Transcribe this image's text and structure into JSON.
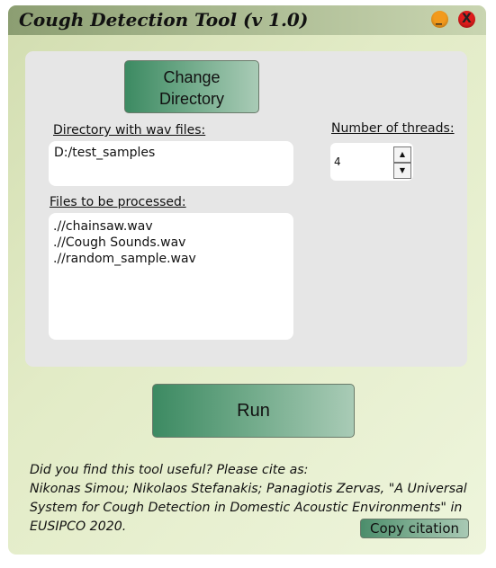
{
  "window": {
    "title": "Cough Detection Tool (v 1.0)",
    "minimize_glyph": "_",
    "close_glyph": "X",
    "colors": {
      "minimize": "#f29a1c",
      "close": "#e01c1c",
      "button_green": "#3c8a62"
    }
  },
  "directory": {
    "change_label_line1": "Change",
    "change_label_line2": "Directory",
    "label": "Directory with wav files:",
    "value": "D:/test_samples"
  },
  "threads": {
    "label": "Number of threads:",
    "value": "4",
    "up_icon": "triangle-up",
    "down_icon": "triangle-down"
  },
  "files": {
    "label": "Files to be processed:",
    "items": [
      ".//chainsaw.wav",
      ".//Cough Sounds.wav",
      ".//random_sample.wav"
    ]
  },
  "run": {
    "label": "Run"
  },
  "citation": {
    "lines": [
      "Did you find this tool useful? Please cite as:",
      "Nikonas Simou; Nikolaos Stefanakis; Panagiotis Zervas, \"A Universal",
      "System for Cough Detection in Domestic Acoustic Environments\" in",
      "EUSIPCO 2020."
    ],
    "copy_label": "Copy citation"
  }
}
